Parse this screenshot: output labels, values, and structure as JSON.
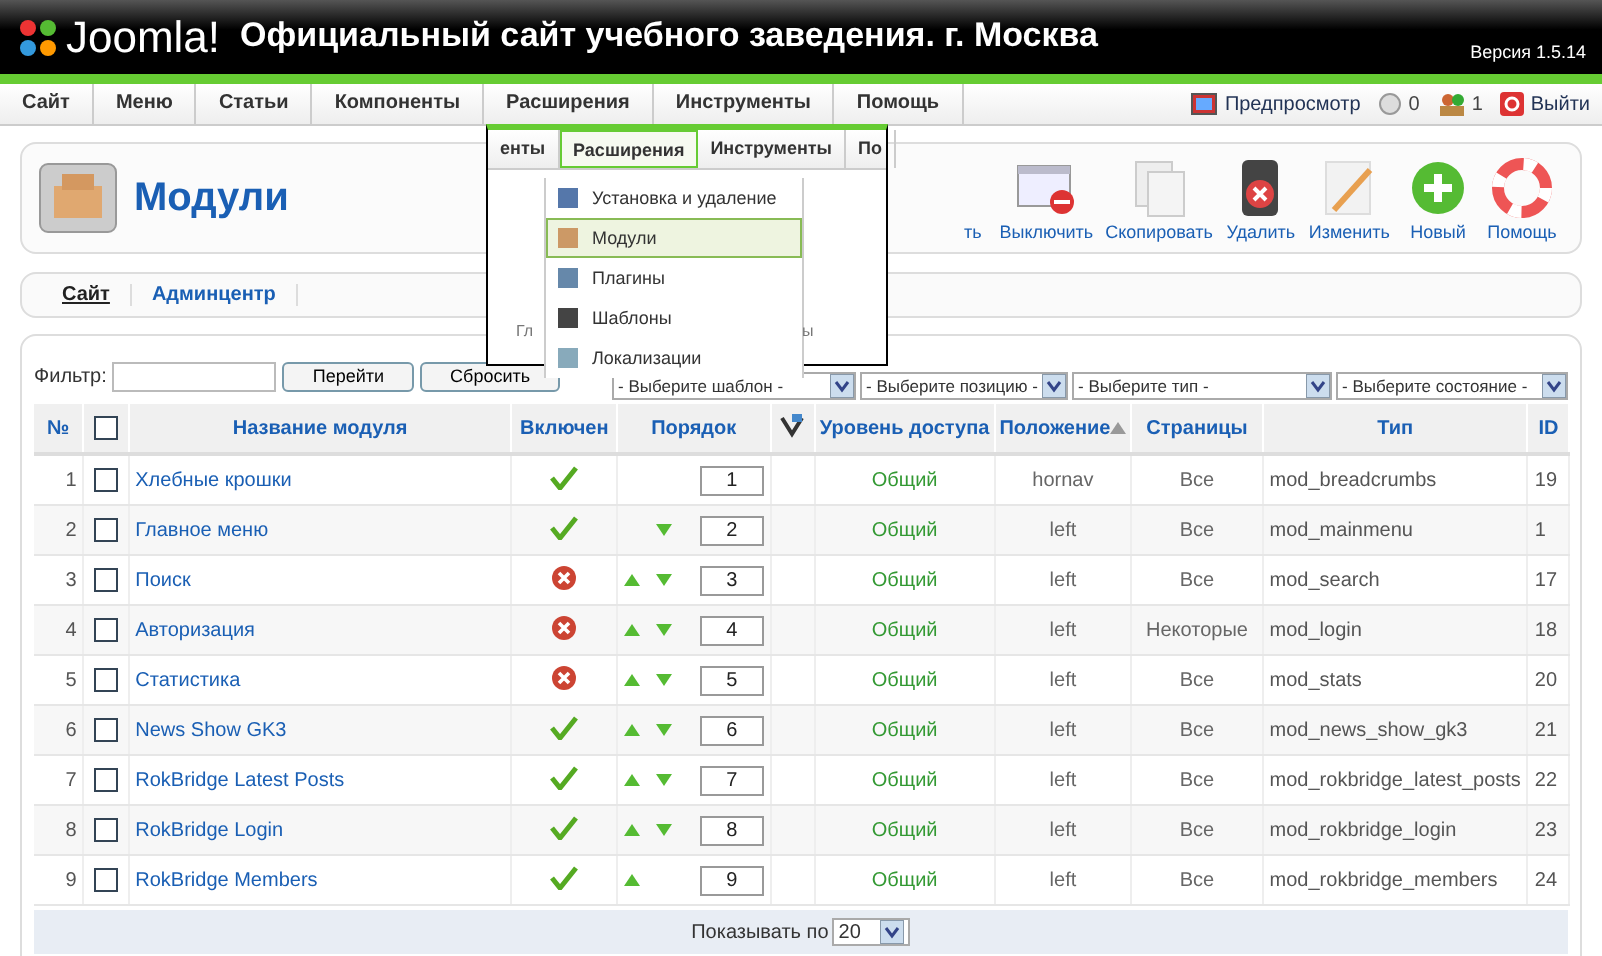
{
  "header": {
    "logo": "Joomla!",
    "title": "Официальный сайт учебного заведения. г. Москва",
    "version": "Версия 1.5.14"
  },
  "menu": [
    {
      "label": "Сайт"
    },
    {
      "label": "Меню"
    },
    {
      "label": "Статьи"
    },
    {
      "label": "Компоненты"
    },
    {
      "label": "Расширения"
    },
    {
      "label": "Инструменты"
    },
    {
      "label": "Помощь"
    }
  ],
  "status": [
    {
      "kind": "preview",
      "label": "Предпросмотр"
    },
    {
      "kind": "messages",
      "label": "0"
    },
    {
      "kind": "users",
      "label": "1"
    },
    {
      "kind": "logout",
      "label": "Выйти"
    }
  ],
  "page_title": "Модули",
  "toolbar": [
    {
      "kind": "hidden",
      "label": "ть"
    },
    {
      "kind": "disable",
      "label": "Выключить"
    },
    {
      "kind": "copy",
      "label": "Скопировать"
    },
    {
      "kind": "delete",
      "label": "Удалить"
    },
    {
      "kind": "edit",
      "label": "Изменить"
    },
    {
      "kind": "new",
      "label": "Новый"
    },
    {
      "kind": "help",
      "label": "Помощь"
    }
  ],
  "submenu": [
    {
      "label": "Сайт",
      "selected": true
    },
    {
      "label": "Админцентр",
      "selected": false
    }
  ],
  "filter": {
    "label": "Фильтр:",
    "buttons": [
      "Перейти",
      "Сбросить"
    ],
    "selects": [
      "- Выберите шаблон -",
      "- Выберите позицию -",
      "- Выберите тип -",
      "- Выберите состояние -"
    ]
  },
  "table": {
    "columns": [
      {
        "label": "№",
        "sorted": false
      },
      {
        "kind": "checkbox",
        "checked": false
      },
      {
        "label": "Название модуля",
        "sorted": false
      },
      {
        "label": "Включен",
        "sorted": false
      },
      {
        "label": "Порядок",
        "sorted": false
      },
      {
        "kind": "save-order"
      },
      {
        "label": "Уровень доступа",
        "sorted": false
      },
      {
        "label": "Положение",
        "sorted": true
      },
      {
        "label": "Страницы",
        "sorted": false
      },
      {
        "label": "Тип",
        "sorted": false
      },
      {
        "label": "ID",
        "sorted": false
      }
    ],
    "rows": [
      {
        "num": "1",
        "checked": false,
        "name": "Хлебные крошки",
        "enabled": true,
        "up": false,
        "down": false,
        "order": "1",
        "access": "Общий",
        "position": "hornav",
        "pages": "Все",
        "type": "mod_breadcrumbs",
        "id": "19"
      },
      {
        "num": "2",
        "checked": false,
        "name": "Главное меню",
        "enabled": true,
        "up": false,
        "down": true,
        "order": "2",
        "access": "Общий",
        "position": "left",
        "pages": "Все",
        "type": "mod_mainmenu",
        "id": "1"
      },
      {
        "num": "3",
        "checked": false,
        "name": "Поиск",
        "enabled": false,
        "up": true,
        "down": true,
        "order": "3",
        "access": "Общий",
        "position": "left",
        "pages": "Все",
        "type": "mod_search",
        "id": "17"
      },
      {
        "num": "4",
        "checked": false,
        "name": "Авторизация",
        "enabled": false,
        "up": true,
        "down": true,
        "order": "4",
        "access": "Общий",
        "position": "left",
        "pages": "Некоторые",
        "type": "mod_login",
        "id": "18"
      },
      {
        "num": "5",
        "checked": false,
        "name": "Статистика",
        "enabled": false,
        "up": true,
        "down": true,
        "order": "5",
        "access": "Общий",
        "position": "left",
        "pages": "Все",
        "type": "mod_stats",
        "id": "20"
      },
      {
        "num": "6",
        "checked": false,
        "name": "News Show GK3",
        "enabled": true,
        "up": true,
        "down": true,
        "order": "6",
        "access": "Общий",
        "position": "left",
        "pages": "Все",
        "type": "mod_news_show_gk3",
        "id": "21"
      },
      {
        "num": "7",
        "checked": false,
        "name": "RokBridge Latest Posts",
        "enabled": true,
        "up": true,
        "down": true,
        "order": "7",
        "access": "Общий",
        "position": "left",
        "pages": "Все",
        "type": "mod_rokbridge_latest_posts",
        "id": "22"
      },
      {
        "num": "8",
        "checked": false,
        "name": "RokBridge Login",
        "enabled": true,
        "up": true,
        "down": true,
        "order": "8",
        "access": "Общий",
        "position": "left",
        "pages": "Все",
        "type": "mod_rokbridge_login",
        "id": "23"
      },
      {
        "num": "9",
        "checked": false,
        "name": "RokBridge Members",
        "enabled": true,
        "up": true,
        "down": false,
        "order": "9",
        "access": "Общий",
        "position": "left",
        "pages": "Все",
        "type": "mod_rokbridge_members",
        "id": "24"
      }
    ],
    "footer": {
      "label": "Показывать по",
      "value": "20"
    }
  },
  "popup": {
    "tabs": [
      {
        "label": "енты",
        "selected": false
      },
      {
        "label": "Расширения",
        "selected": true
      },
      {
        "label": "Инструменты",
        "selected": false
      },
      {
        "label": "По",
        "selected": false
      }
    ],
    "items": [
      {
        "kind": "install",
        "label": "Установка и удаление",
        "selected": false
      },
      {
        "kind": "modules",
        "label": "Модули",
        "selected": true
      },
      {
        "kind": "plugins",
        "label": "Плагины",
        "selected": false
      },
      {
        "kind": "templates",
        "label": "Шаблоны",
        "selected": false
      },
      {
        "kind": "languages",
        "label": "Локализации",
        "selected": false
      }
    ],
    "fragments": [
      "Гл",
      "ы"
    ]
  }
}
